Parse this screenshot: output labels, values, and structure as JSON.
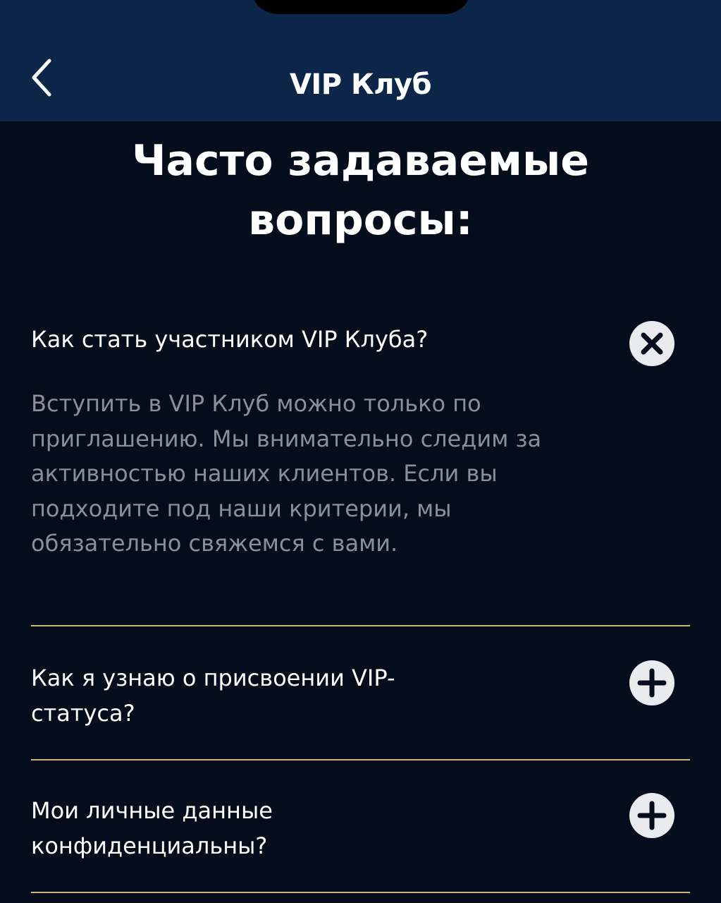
{
  "header": {
    "title": "VIP Клуб",
    "back_icon": "chevron-left-icon"
  },
  "page": {
    "title_line1": "Часто задаваемые",
    "title_line2": "вопросы:"
  },
  "faq": [
    {
      "question": "Как стать участником VIP Клуба?",
      "answer": "Вступить в VIP Клуб можно только по приглашению. Мы внимательно следим за активностью наших клиентов. Если вы подходите под наши критерии, мы обязательно свяжемся с вами.",
      "expanded": true,
      "toggle_icon": "close-circle-icon"
    },
    {
      "question": "Как я узнаю о присвоении VIP-статуса?",
      "expanded": false,
      "toggle_icon": "plus-circle-icon"
    },
    {
      "question": "Мои личные данные конфиденциальны?",
      "expanded": false,
      "toggle_icon": "plus-circle-icon"
    }
  ],
  "colors": {
    "header_bg": "#0b2649",
    "page_bg": "#050c1c",
    "divider": "#c9b37a",
    "answer_text": "#8a8f99",
    "icon_fill": "#e9ebef"
  }
}
